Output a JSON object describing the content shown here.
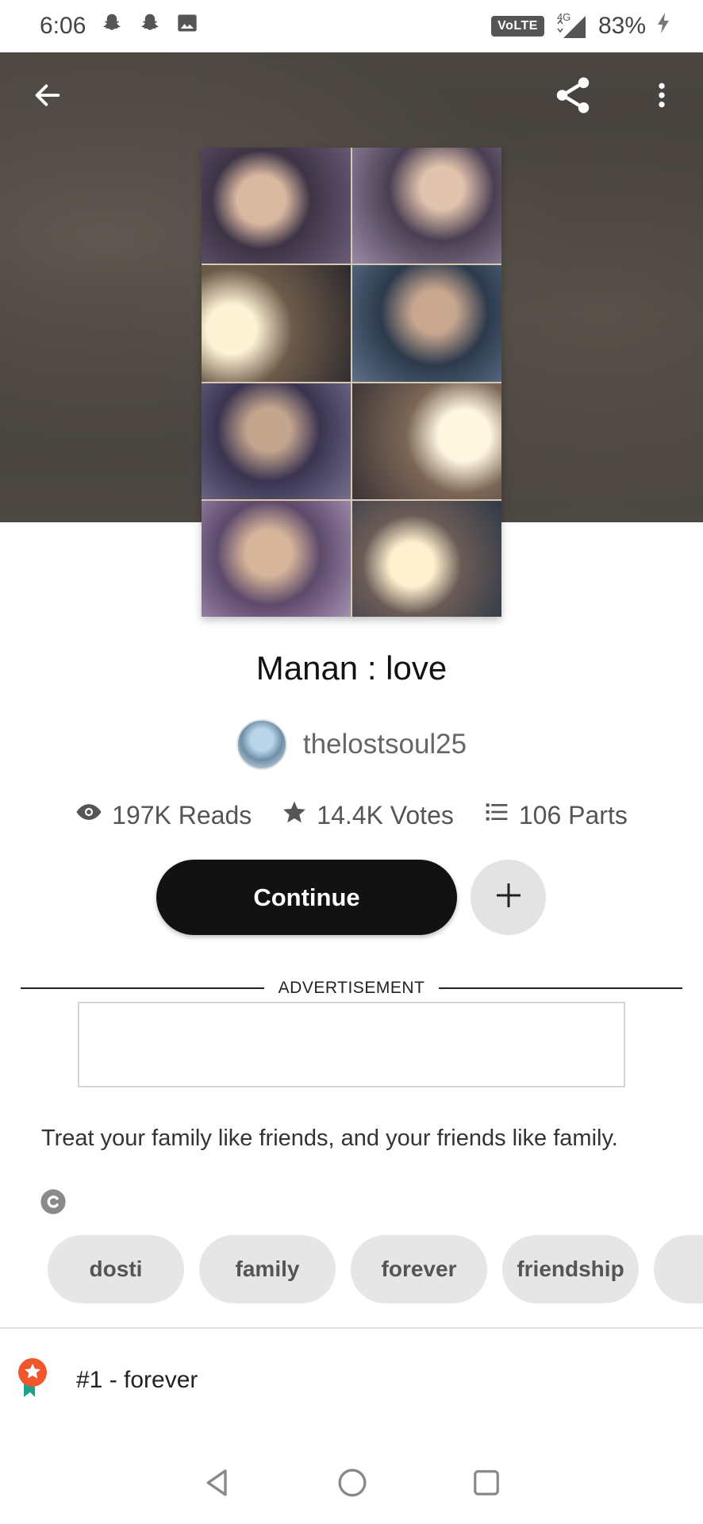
{
  "status_bar": {
    "time": "6:06",
    "left_icons": [
      "snapchat-icon",
      "snapchat-icon",
      "image-icon"
    ],
    "volte": "VoLTE",
    "network": "4G",
    "battery": "83%"
  },
  "header": {
    "back_icon": "arrow-left-icon",
    "share_icon": "share-icon",
    "more_icon": "more-vertical-icon"
  },
  "story": {
    "title": "Manan : love",
    "author": "thelostsoul25",
    "reads": "197K Reads",
    "votes": "14.4K Votes",
    "parts": "106 Parts",
    "description": "Treat your family like friends, and your friends like family."
  },
  "actions": {
    "continue_label": "Continue",
    "add_icon": "plus-icon"
  },
  "ad": {
    "label": "ADVERTISEMENT"
  },
  "tags": [
    "dosti",
    "family",
    "forever",
    "friendship"
  ],
  "ranking": {
    "text": "#1 - forever",
    "badge_color": "#f0562b",
    "ribbon_color": "#1fa08a"
  },
  "colors": {
    "primary_button": "#121212",
    "secondary_button": "#e3e3e3",
    "tag_bg": "#e6e6e6"
  }
}
